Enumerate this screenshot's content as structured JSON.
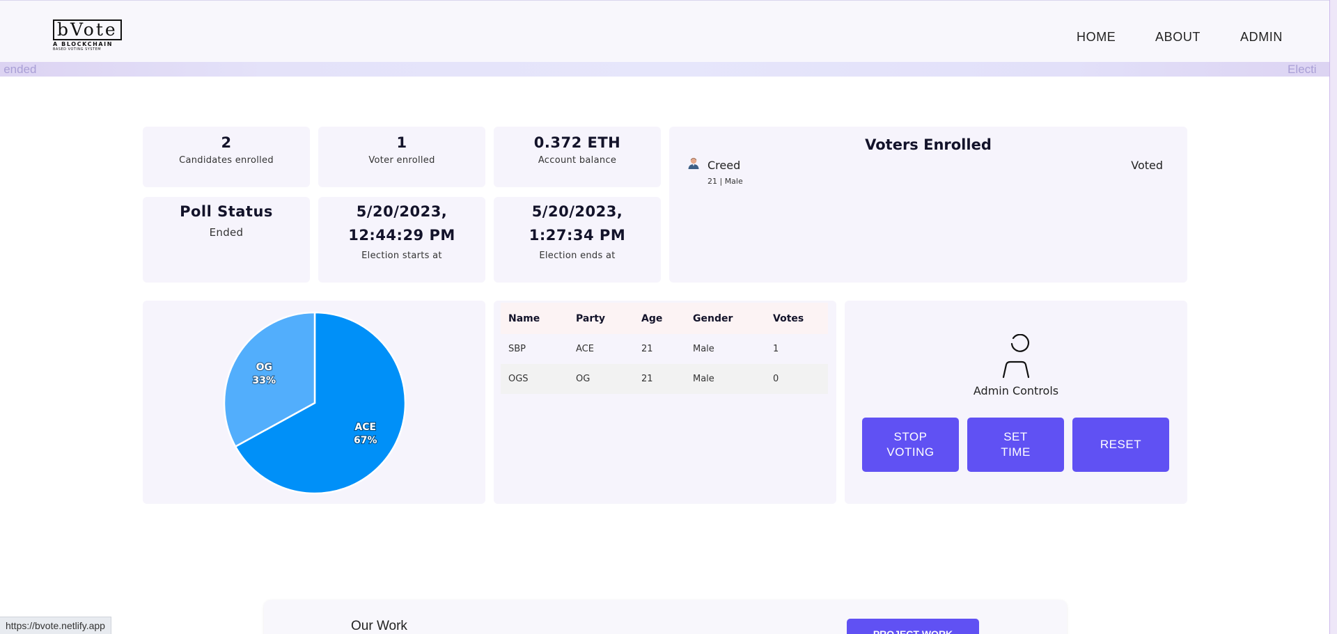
{
  "logo": {
    "title": "bVote",
    "subtitle1": "A BLOCKCHAIN",
    "subtitle2": "BASED VOTING SYSTEM"
  },
  "nav": {
    "home": "HOME",
    "about": "ABOUT",
    "admin": "ADMIN"
  },
  "marquee": {
    "left_text": "s ended",
    "right_text": "Electi"
  },
  "stats": {
    "candidates": {
      "value": "2",
      "label": "Candidates enrolled"
    },
    "voters": {
      "value": "1",
      "label": "Voter enrolled"
    },
    "balance": {
      "value": "0.372 ETH",
      "label": "Account balance"
    },
    "poll": {
      "title": "Poll Status",
      "value": "Ended"
    },
    "start": {
      "date": "5/20/2023,",
      "time": "12:44:29 PM",
      "label": "Election starts at"
    },
    "end": {
      "date": "5/20/2023,",
      "time": "1:27:34 PM",
      "label": "Election ends at"
    }
  },
  "voters_panel": {
    "title": "Voters Enrolled",
    "voters": [
      {
        "name": "Creed",
        "details": "21 | Male",
        "status": "Voted",
        "icon": "user-avatar-icon"
      }
    ]
  },
  "chart_data": {
    "type": "pie",
    "categories": [
      "OG",
      "ACE"
    ],
    "values": [
      33,
      67
    ],
    "labels": [
      "33%",
      "67%"
    ],
    "colors": [
      "#52aefc",
      "#0090f8"
    ]
  },
  "candidates_table": {
    "headers": [
      "Name",
      "Party",
      "Age",
      "Gender",
      "Votes"
    ],
    "rows": [
      [
        "SBP",
        "ACE",
        "21",
        "Male",
        "1"
      ],
      [
        "OGS",
        "OG",
        "21",
        "Male",
        "0"
      ]
    ]
  },
  "admin": {
    "title": "Admin Controls",
    "icon": "admin-person-icon",
    "stop_line1": "STOP",
    "stop_line2": "VOTING",
    "set_line1": "SET",
    "set_line2": "TIME",
    "reset": "RESET"
  },
  "work": {
    "title": "Our Work",
    "button": "PROJECT WORK"
  },
  "status_bar": {
    "url": "https://bvote.netlify.app"
  },
  "colors": {
    "accent": "#6051f3",
    "card_bg": "#f6f4fc",
    "nav_bg": "#f8f7fc"
  }
}
